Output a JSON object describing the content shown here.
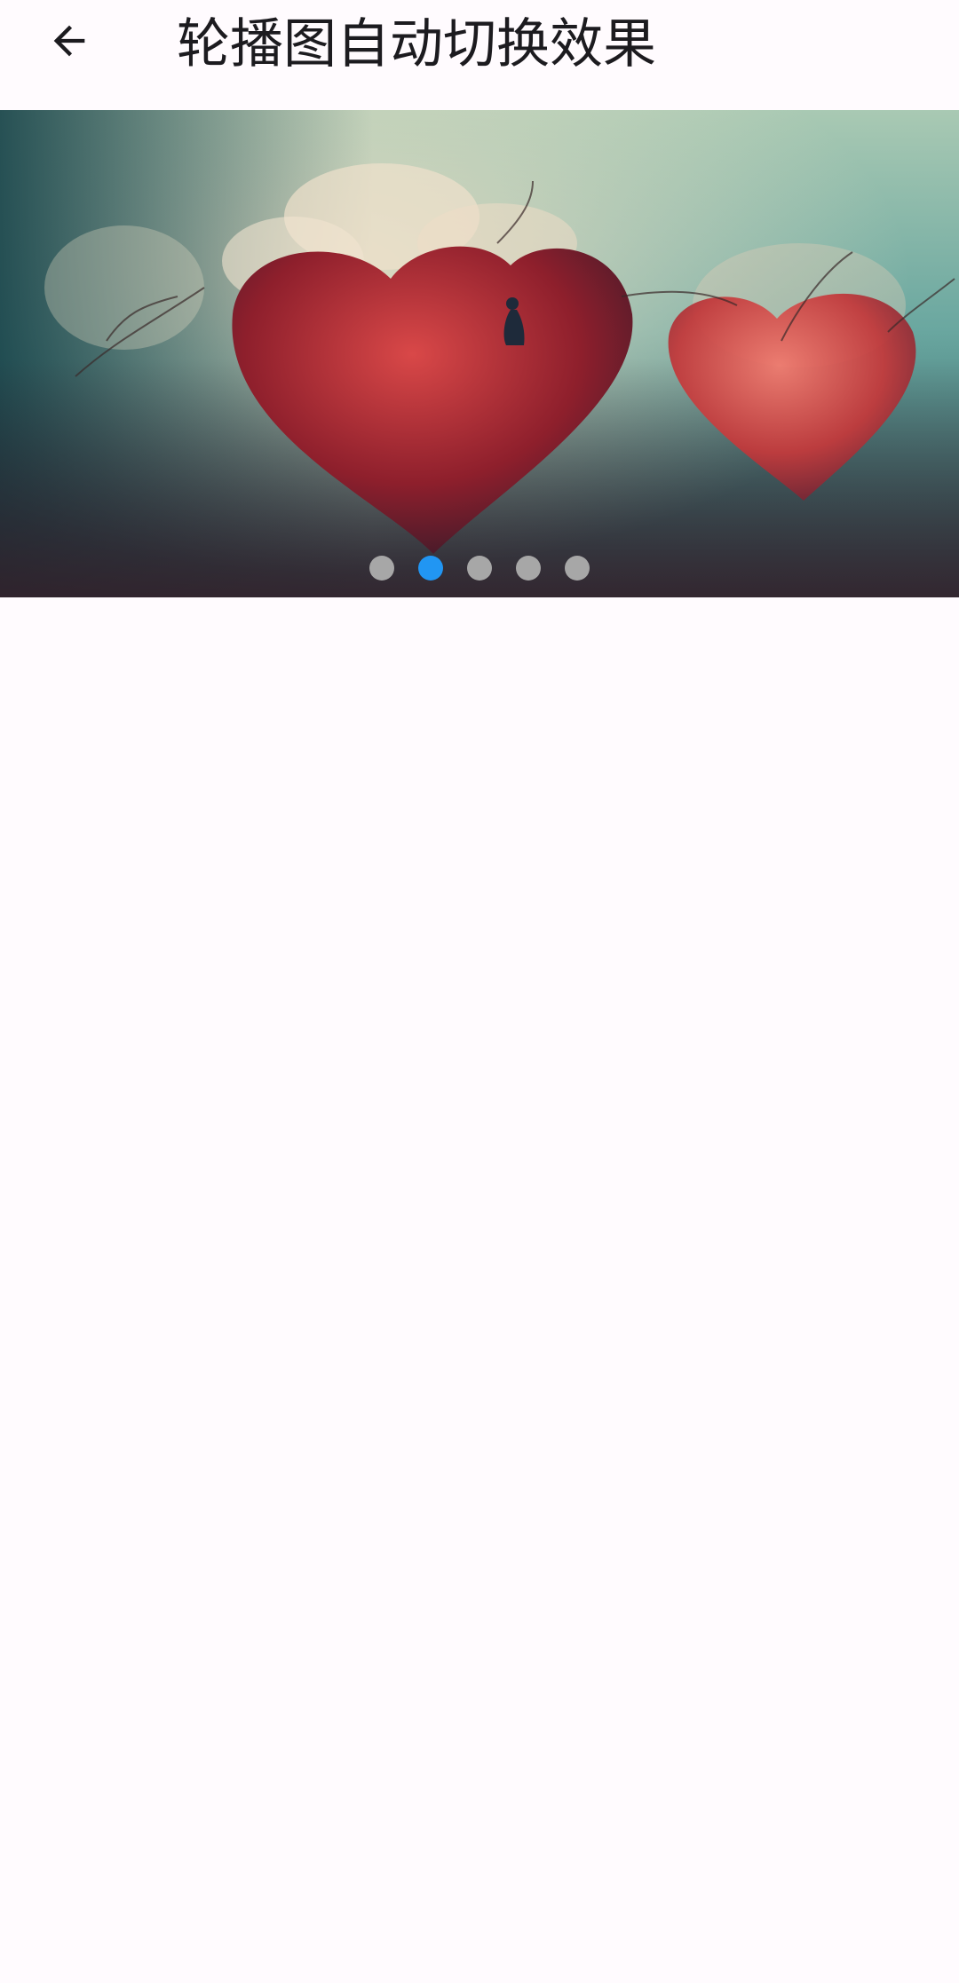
{
  "header": {
    "title": "轮播图自动切换效果",
    "back_icon": "arrow-back-icon"
  },
  "carousel": {
    "slide_count": 5,
    "active_index": 1,
    "current_slide_description": "heart-tree-artwork",
    "colors": {
      "active_dot": "#2196f3",
      "inactive_dot": "#a7a7a7"
    }
  },
  "theme": {
    "background": "#fffbfe",
    "text": "#1c1b1f"
  }
}
